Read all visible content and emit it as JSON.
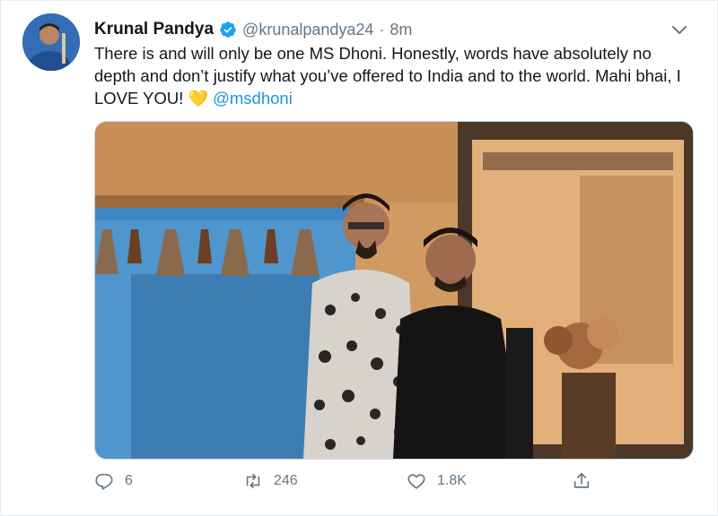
{
  "tweet": {
    "display_name": "Krunal Pandya",
    "handle": "@krunalpandya24",
    "separator": "·",
    "time": "8m",
    "text_main": "There is and will only be one MS Dhoni. Honestly, words have absolutely no depth and don’t justify what you’ve offered to India and to the world. Mahi bhai, I LOVE YOU!",
    "emoji": "💛",
    "mention": "@msdhoni",
    "colors": {
      "accent": "#1b95e0",
      "muted": "#657786",
      "verified": "#1da1f2",
      "heart": "#ffc83d"
    }
  },
  "actions": {
    "reply": {
      "icon": "reply-icon",
      "count": "6"
    },
    "retweet": {
      "icon": "retweet-icon",
      "count": "246"
    },
    "like": {
      "icon": "heart-icon",
      "count": "1.8K"
    },
    "share": {
      "icon": "share-icon"
    }
  },
  "media": {
    "icon": "photo-two-men"
  }
}
